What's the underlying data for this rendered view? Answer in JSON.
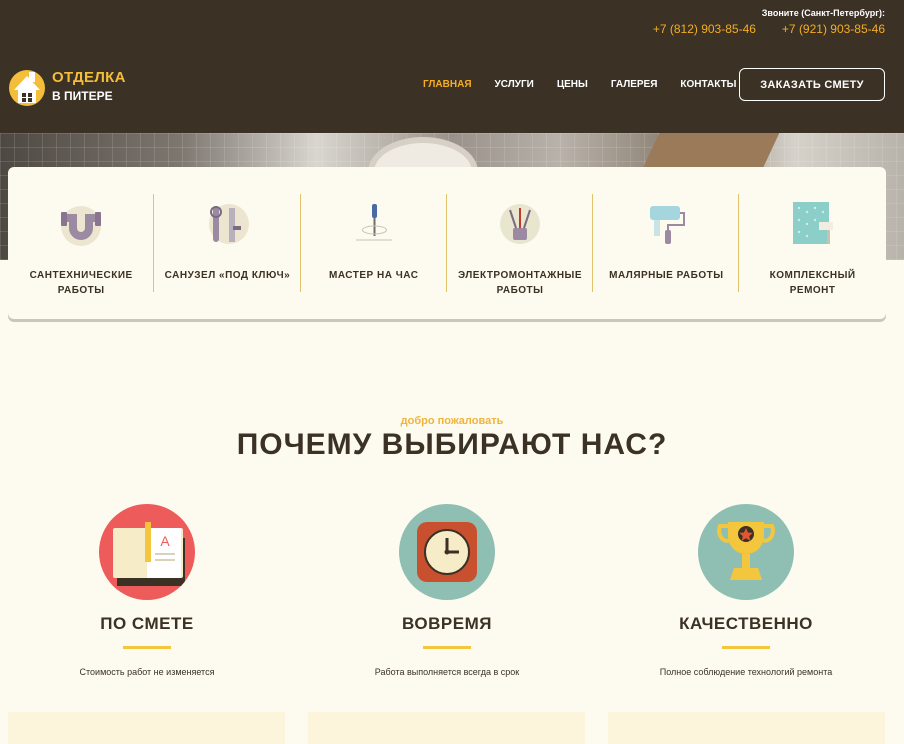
{
  "header": {
    "call_label": "Звоните (Санкт-Петербург):",
    "phones": [
      "+7 (812) 903-85-46",
      "+7 (921) 903-85-46"
    ],
    "logo_line1": "ОТДЕЛКА",
    "logo_line2": "В ПИТЕРЕ",
    "nav": [
      {
        "label": "ГЛАВНАЯ",
        "active": true
      },
      {
        "label": "УСЛУГИ",
        "active": false
      },
      {
        "label": "ЦЕНЫ",
        "active": false
      },
      {
        "label": "ГАЛЕРЕЯ",
        "active": false
      },
      {
        "label": "КОНТАКТЫ",
        "active": false
      }
    ],
    "order_button": "ЗАКАЗАТЬ СМЕТУ"
  },
  "services": [
    {
      "label": "САНТЕХНИЧЕСКИЕ РАБОТЫ",
      "icon": "pipe-icon"
    },
    {
      "label": "САНУЗЕЛ «ПОД КЛЮЧ»",
      "icon": "wrench-icon"
    },
    {
      "label": "МАСТЕР НА ЧАС",
      "icon": "screwdriver-icon"
    },
    {
      "label": "ЭЛЕКТРОМОНТАЖНЫЕ РАБОТЫ",
      "icon": "wires-icon"
    },
    {
      "label": "МАЛЯРНЫЕ РАБОТЫ",
      "icon": "paint-roller-icon"
    },
    {
      "label": "КОМПЛЕКСНЫЙ РЕМОНТ",
      "icon": "wallpaper-icon"
    }
  ],
  "why": {
    "welcome": "добро пожаловать",
    "title": "ПОЧЕМУ ВЫБИРАЮТ НАС?",
    "features": [
      {
        "title": "ПО СМЕТЕ",
        "desc": "Стоимость работ не изменяется",
        "icon": "book-icon",
        "letter": "A",
        "color": "#ee5b5b"
      },
      {
        "title": "ВОВРЕМЯ",
        "desc": "Работа выполняется всегда в срок",
        "icon": "clock-icon",
        "color": "#8fbfb3"
      },
      {
        "title": "КАЧЕСТВЕННО",
        "desc": "Полное соблюдение технологий ремонта",
        "icon": "trophy-icon",
        "color": "#8fbfb3"
      }
    ]
  },
  "colors": {
    "header_bg": "#3b3125",
    "accent": "#f4ad24",
    "page_bg": "#fdfbef",
    "divider": "#e2c36c"
  }
}
